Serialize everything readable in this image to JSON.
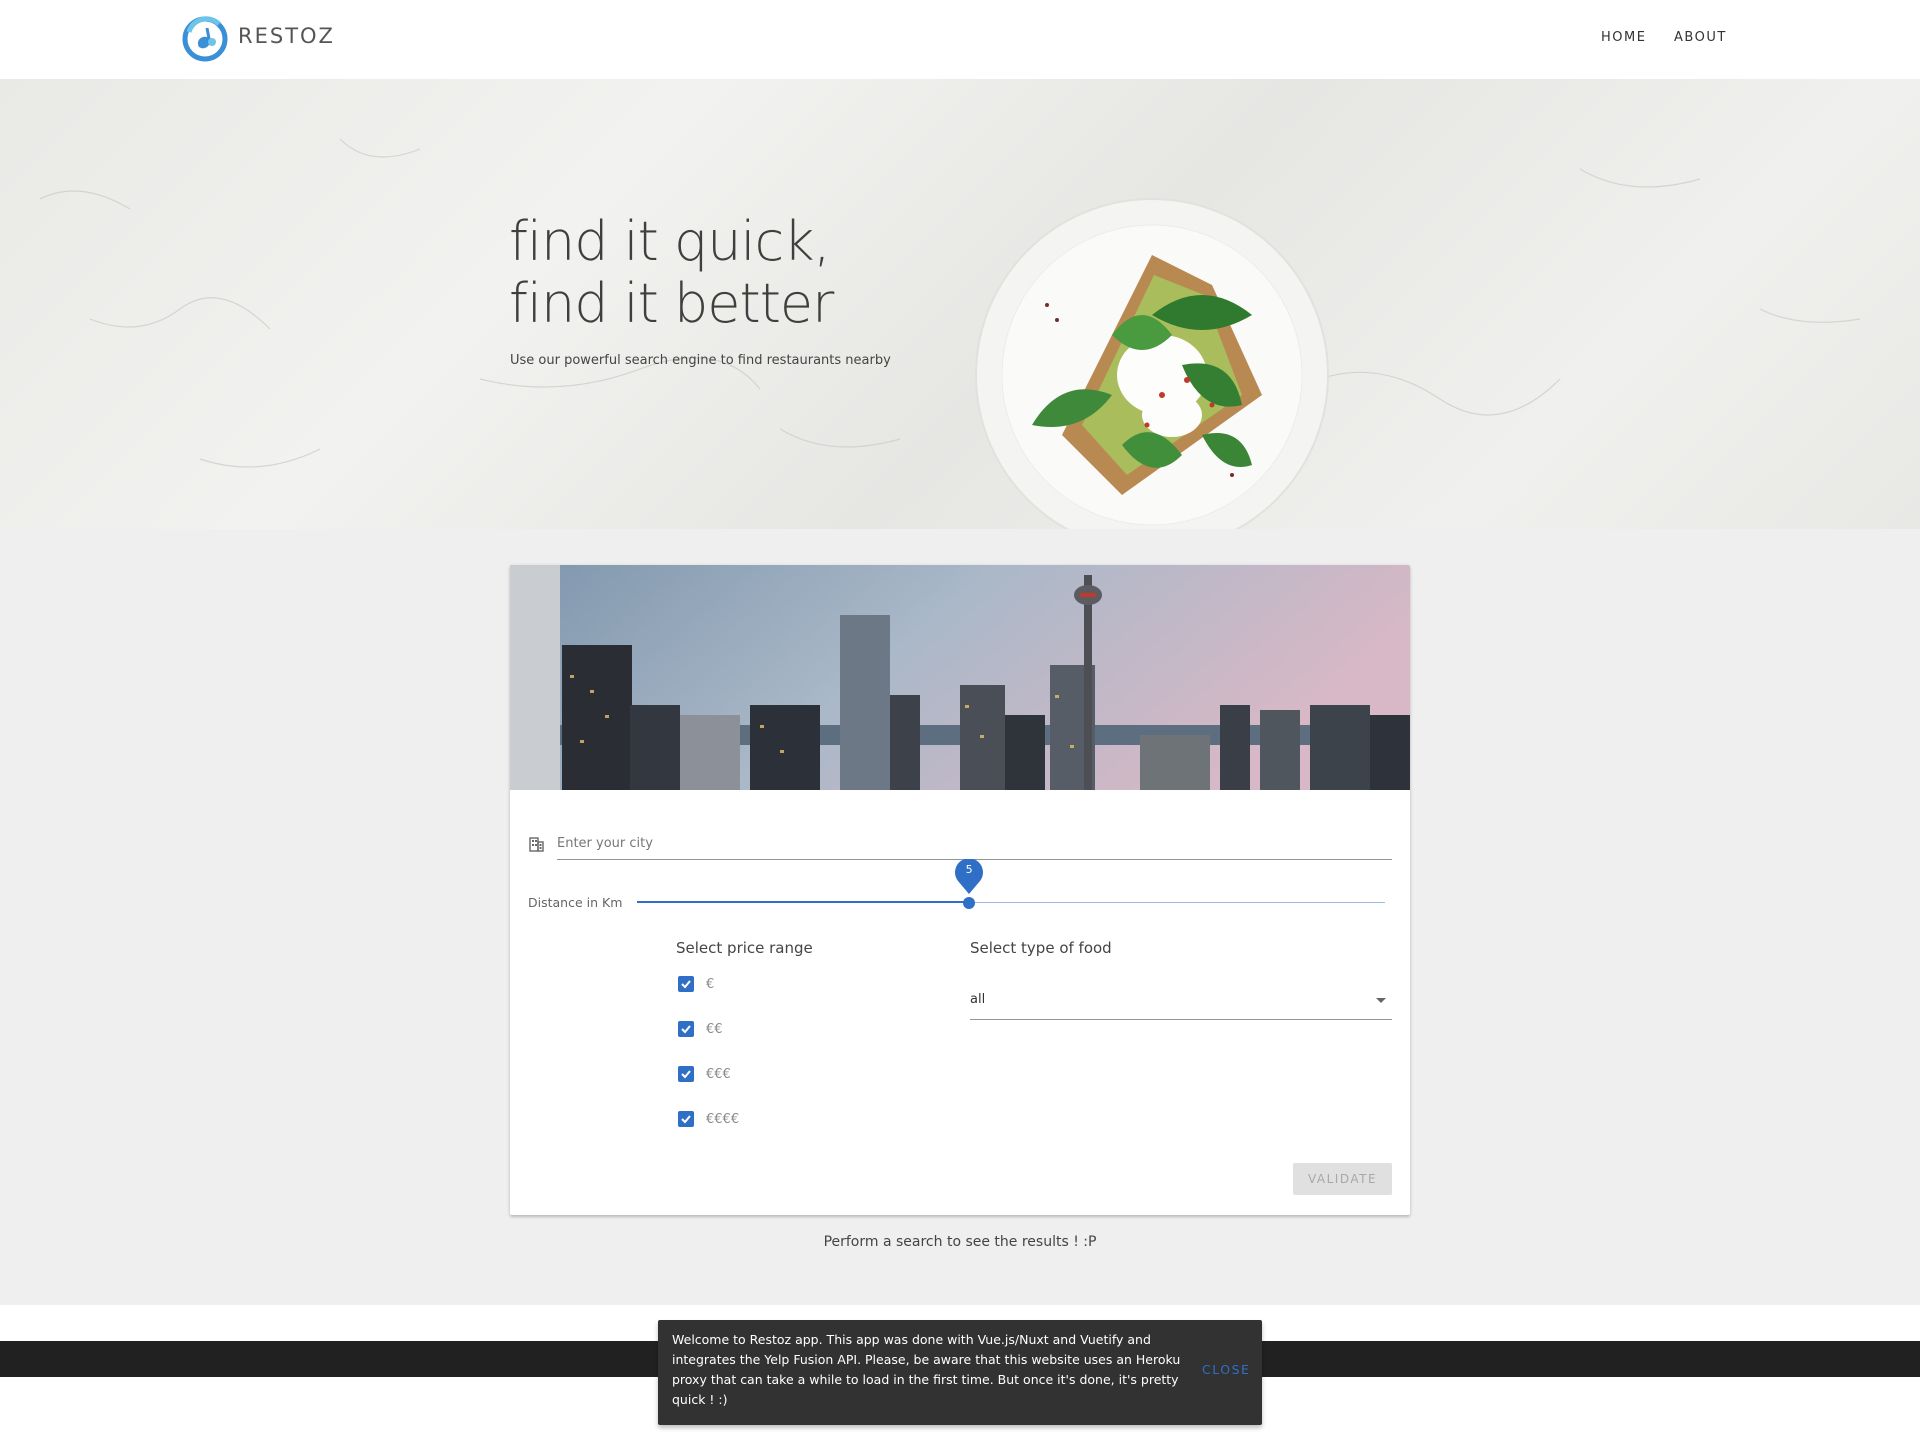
{
  "header": {
    "brand": "RESTOZ",
    "nav": {
      "home": "HOME",
      "about": "ABOUT"
    }
  },
  "hero": {
    "title_line1": "find it quick,",
    "title_line2": "find it better",
    "subtitle": "Use our powerful search engine to find restaurants nearby"
  },
  "search": {
    "city_placeholder": "Enter your city",
    "city_value": "",
    "distance_label": "Distance in Km",
    "distance_value": 5,
    "distance_display": "5",
    "distance_fraction": 0.444,
    "price_title": "Select price range",
    "prices": [
      {
        "label": "€",
        "checked": true
      },
      {
        "label": "€€",
        "checked": true
      },
      {
        "label": "€€€",
        "checked": true
      },
      {
        "label": "€€€€",
        "checked": true
      }
    ],
    "food_title": "Select type of food",
    "food_value": "all",
    "validate_label": "VALIDATE"
  },
  "results": {
    "message": "Perform a search to see the results ! :P"
  },
  "snackbar": {
    "text": "Welcome to Restoz app. This app was done with Vue.js/Nuxt and Vuetify and integrates the Yelp Fusion API. Please, be aware that this website uses an Heroku proxy that can take a while to load in the first time. But once it's done, it's pretty quick ! :)",
    "close_label": "CLOSE"
  },
  "colors": {
    "primary": "#2f6fc6",
    "dark": "#212121",
    "snackbar": "#323232"
  }
}
